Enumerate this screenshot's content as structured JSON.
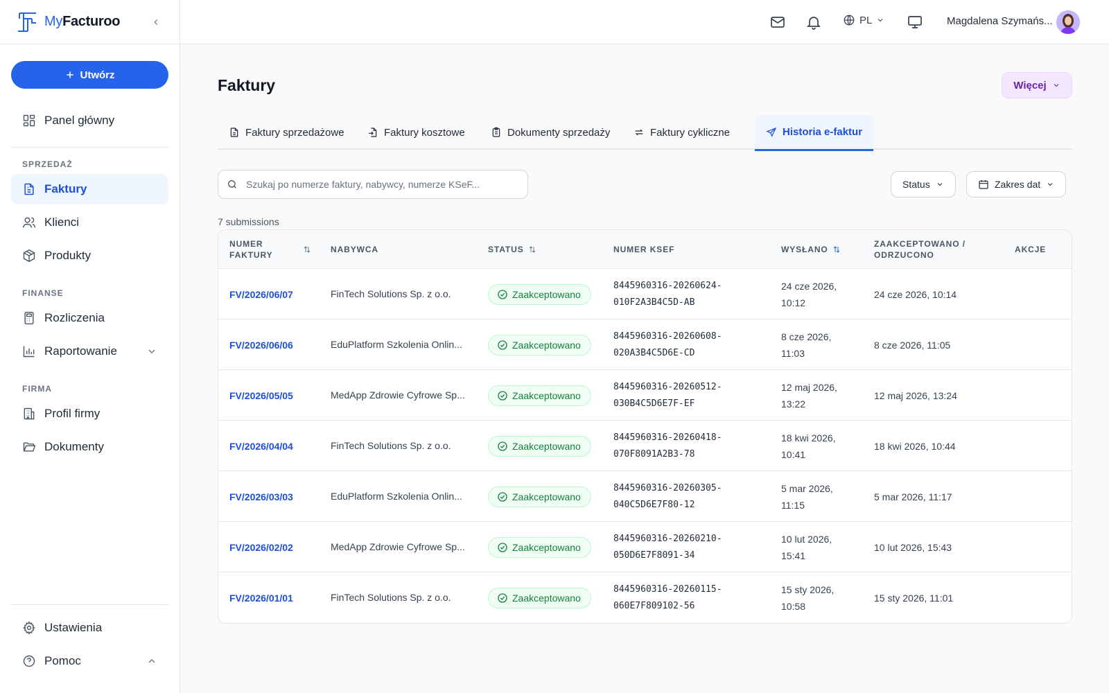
{
  "app": {
    "brand_part1": "My",
    "brand_part2": "Facturoo"
  },
  "sidebar": {
    "create_label": "Utwórz",
    "main_item": "Panel główny",
    "sections": {
      "sales": "SPRZEDAŻ",
      "finance": "FINANSE",
      "company": "FIRMA"
    },
    "items": {
      "invoices": "Faktury",
      "clients": "Klienci",
      "products": "Produkty",
      "settlements": "Rozliczenia",
      "reporting": "Raportowanie",
      "company_profile": "Profil firmy",
      "documents": "Dokumenty",
      "settings": "Ustawienia",
      "help": "Pomoc"
    }
  },
  "topbar": {
    "language": "PL",
    "user_name": "Magdalena Szymańs..."
  },
  "page": {
    "title": "Faktury",
    "more_label": "Więcej",
    "tabs": [
      {
        "label": "Faktury sprzedażowe"
      },
      {
        "label": "Faktury kosztowe"
      },
      {
        "label": "Dokumenty sprzedaży"
      },
      {
        "label": "Faktury cykliczne"
      },
      {
        "label": "Historia e-faktur"
      }
    ],
    "search_placeholder": "Szukaj po numerze faktury, nabywcy, numerze KSeF...",
    "filters": {
      "status": "Status",
      "date_range": "Zakres dat"
    },
    "count_label": "7 submissions"
  },
  "table": {
    "headers": {
      "invoice_number": "NUMER\nFAKTURY",
      "buyer": "NABYWCA",
      "status": "STATUS",
      "ksef": "NUMER KSEF",
      "sent": "WYSŁANO",
      "accepted": "ZAAKCEPTOWANO /\nODRZUCONO",
      "actions": "AKCJE"
    },
    "rows": [
      {
        "invoice": "FV/2026/06/07",
        "buyer": "FinTech Solutions Sp. z o.o.",
        "status": "Zaakceptowano",
        "ksef": "8445960316-20260624-\n010F2A3B4C5D-AB",
        "sent": "24 cze 2026,\n10:12",
        "accepted": "24 cze 2026, 10:14"
      },
      {
        "invoice": "FV/2026/06/06",
        "buyer": "EduPlatform Szkolenia Onlin...",
        "status": "Zaakceptowano",
        "ksef": "8445960316-20260608-\n020A3B4C5D6E-CD",
        "sent": "8 cze 2026,\n11:03",
        "accepted": "8 cze 2026, 11:05"
      },
      {
        "invoice": "FV/2026/05/05",
        "buyer": "MedApp Zdrowie Cyfrowe Sp...",
        "status": "Zaakceptowano",
        "ksef": "8445960316-20260512-\n030B4C5D6E7F-EF",
        "sent": "12 maj 2026,\n13:22",
        "accepted": "12 maj 2026, 13:24"
      },
      {
        "invoice": "FV/2026/04/04",
        "buyer": "FinTech Solutions Sp. z o.o.",
        "status": "Zaakceptowano",
        "ksef": "8445960316-20260418-\n070F8091A2B3-78",
        "sent": "18 kwi 2026,\n10:41",
        "accepted": "18 kwi 2026, 10:44"
      },
      {
        "invoice": "FV/2026/03/03",
        "buyer": "EduPlatform Szkolenia Onlin...",
        "status": "Zaakceptowano",
        "ksef": "8445960316-20260305-\n040C5D6E7F80-12",
        "sent": "5 mar 2026,\n11:15",
        "accepted": "5 mar 2026, 11:17"
      },
      {
        "invoice": "FV/2026/02/02",
        "buyer": "MedApp Zdrowie Cyfrowe Sp...",
        "status": "Zaakceptowano",
        "ksef": "8445960316-20260210-\n050D6E7F8091-34",
        "sent": "10 lut 2026,\n15:41",
        "accepted": "10 lut 2026, 15:43"
      },
      {
        "invoice": "FV/2026/01/01",
        "buyer": "FinTech Solutions Sp. z o.o.",
        "status": "Zaakceptowano",
        "ksef": "8445960316-20260115-\n060E7F809102-56",
        "sent": "15 sty 2026,\n10:58",
        "accepted": "15 sty 2026, 11:01"
      }
    ]
  },
  "colors": {
    "primary": "#2563eb",
    "success": "#15803d",
    "more_bg": "#f3e8ff",
    "more_text": "#6b21a8"
  }
}
